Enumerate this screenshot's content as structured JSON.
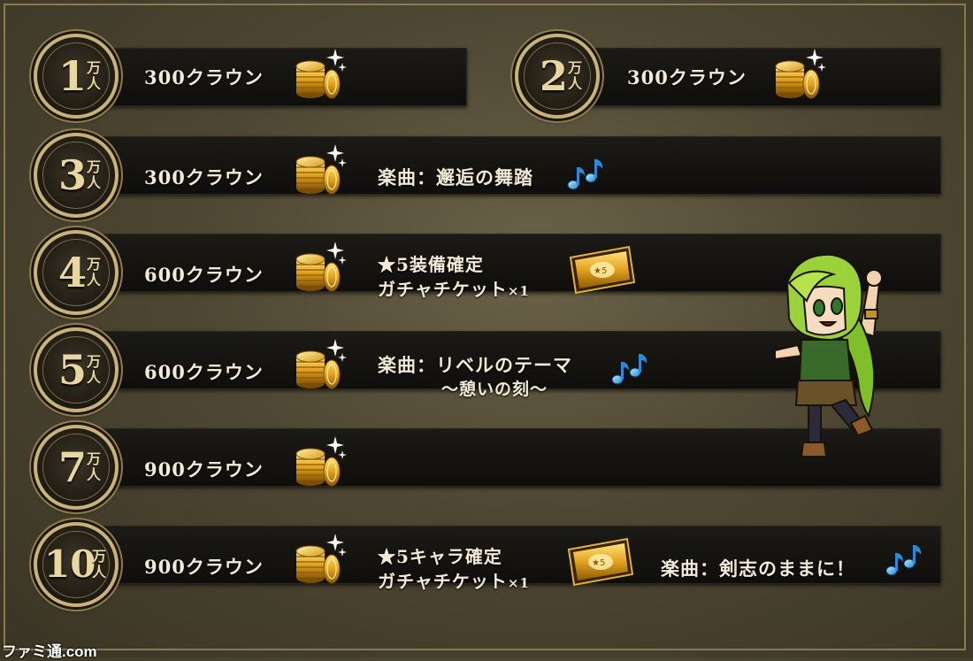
{
  "rewards": [
    {
      "num": "1",
      "crowns": "300クラウン"
    },
    {
      "num": "2",
      "crowns": "300クラウン"
    },
    {
      "num": "3",
      "crowns": "300クラウン",
      "song": "楽曲：邂逅の舞踏"
    },
    {
      "num": "4",
      "crowns": "600クラウン",
      "ticket_line1": "★5装備確定",
      "ticket_line2": "ガチャチケット",
      "ticket_count": "×1"
    },
    {
      "num": "5",
      "crowns": "600クラウン",
      "song_line1": "楽曲：リベルのテーマ",
      "song_line2": "～憩いの刻～"
    },
    {
      "num": "7",
      "crowns": "900クラウン"
    },
    {
      "num": "10",
      "crowns": "900クラウン",
      "ticket_line1": "★5キャラ確定",
      "ticket_line2": "ガチャチケット",
      "ticket_count": "×1",
      "song": "楽曲：剣志のままに！"
    }
  ],
  "unit": {
    "man": "万",
    "hito": "人"
  },
  "watermark": "ファミ通.com",
  "icons": {
    "coin": "gold-coin-stack-icon",
    "note": "music-note-icon",
    "ticket": "gacha-ticket-icon",
    "character": "green-haired-character"
  },
  "colors": {
    "row_bg": "#141210",
    "medal_border": "#c9b27a",
    "text": "#f2ead8",
    "note": "#3fa6e0"
  }
}
